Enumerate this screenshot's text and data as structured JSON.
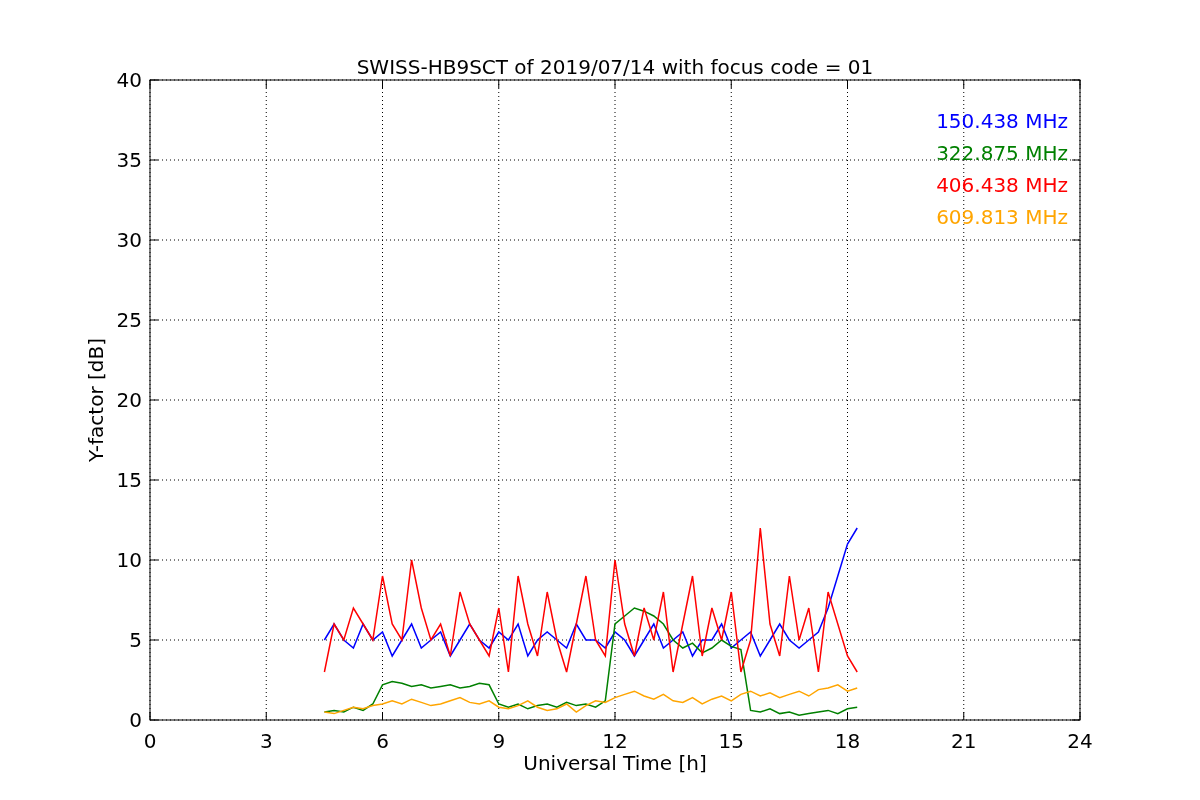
{
  "chart_data": {
    "type": "line",
    "title": "SWISS-HB9SCT of 2019/07/14 with focus code = 01",
    "xlabel": "Universal Time [h]",
    "ylabel": "Y-factor [dB]",
    "x": [
      4.5,
      4.75,
      5,
      5.25,
      5.5,
      5.75,
      6,
      6.25,
      6.5,
      6.75,
      7,
      7.25,
      7.5,
      7.75,
      8,
      8.25,
      8.5,
      8.75,
      9,
      9.25,
      9.5,
      9.75,
      10,
      10.25,
      10.5,
      10.75,
      11,
      11.25,
      11.5,
      11.75,
      12,
      12.25,
      12.5,
      12.75,
      13,
      13.25,
      13.5,
      13.75,
      14,
      14.25,
      14.5,
      14.75,
      15,
      15.25,
      15.5,
      15.75,
      16,
      16.25,
      16.5,
      16.75,
      17,
      17.25,
      17.5,
      17.75,
      18,
      18.25
    ],
    "series": [
      {
        "name": "150.438 MHz",
        "color": "#0000ff",
        "values": [
          5,
          6,
          5,
          4.5,
          6,
          5,
          5.5,
          4,
          5,
          6,
          4.5,
          5,
          5.5,
          4,
          5,
          6,
          5,
          4.5,
          5.5,
          5,
          6,
          4,
          5,
          5.5,
          5,
          4.5,
          6,
          5,
          5,
          4.5,
          5.5,
          5,
          4,
          5,
          6,
          4.5,
          5,
          5.5,
          4,
          5,
          5,
          6,
          4.5,
          5,
          5.5,
          4,
          5,
          6,
          5,
          4.5,
          5,
          5.5,
          7,
          9,
          11,
          12
        ]
      },
      {
        "name": "322.875 MHz",
        "color": "#008000",
        "values": [
          0.5,
          0.6,
          0.5,
          0.8,
          0.6,
          1,
          2.2,
          2.4,
          2.3,
          2.1,
          2.2,
          2,
          2.1,
          2.2,
          2,
          2.1,
          2.3,
          2.2,
          1,
          0.8,
          1,
          0.7,
          0.9,
          1,
          0.8,
          1.1,
          0.9,
          1,
          0.8,
          1.2,
          6,
          6.5,
          7,
          6.8,
          6.5,
          6,
          5,
          4.5,
          4.8,
          4.2,
          4.5,
          5,
          4.6,
          4.4,
          0.6,
          0.5,
          0.7,
          0.4,
          0.5,
          0.3,
          0.4,
          0.5,
          0.6,
          0.4,
          0.7,
          0.8
        ]
      },
      {
        "name": "406.438 MHz",
        "color": "#ff0000",
        "values": [
          3,
          6,
          5,
          7,
          6,
          5,
          9,
          6,
          5,
          10,
          7,
          5,
          6,
          4,
          8,
          6,
          5,
          4,
          7,
          3,
          9,
          6,
          4,
          8,
          5,
          3,
          6,
          9,
          5,
          4,
          10,
          6,
          4,
          7,
          5,
          8,
          3,
          6,
          9,
          4,
          7,
          5,
          8,
          3,
          5,
          12,
          6,
          4,
          9,
          5,
          7,
          3,
          8,
          6,
          4,
          3
        ]
      },
      {
        "name": "609.813 MHz",
        "color": "#ffa500",
        "values": [
          0.5,
          0.4,
          0.6,
          0.8,
          0.7,
          0.9,
          1,
          1.2,
          1,
          1.3,
          1.1,
          0.9,
          1,
          1.2,
          1.4,
          1.1,
          1,
          1.2,
          0.8,
          0.7,
          0.9,
          1.2,
          0.8,
          0.6,
          0.7,
          1,
          0.5,
          0.9,
          1.2,
          1.1,
          1.4,
          1.6,
          1.8,
          1.5,
          1.3,
          1.6,
          1.2,
          1.1,
          1.4,
          1,
          1.3,
          1.5,
          1.2,
          1.6,
          1.8,
          1.5,
          1.7,
          1.4,
          1.6,
          1.8,
          1.5,
          1.9,
          2,
          2.2,
          1.8,
          2
        ]
      }
    ],
    "xlim": [
      0,
      24
    ],
    "ylim": [
      0,
      40
    ],
    "xticks": [
      0,
      3,
      6,
      9,
      12,
      15,
      18,
      21,
      24
    ],
    "yticks": [
      0,
      5,
      10,
      15,
      20,
      25,
      30,
      35,
      40
    ],
    "grid": true
  }
}
